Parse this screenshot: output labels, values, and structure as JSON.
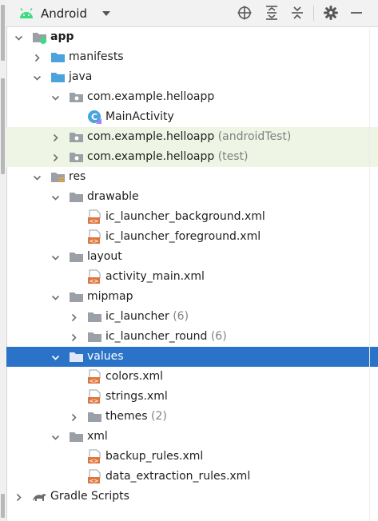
{
  "toolbar": {
    "view_name": "Android",
    "icons": [
      "android-logo-icon",
      "chevron-down-icon",
      "locate-target-icon",
      "expand-all-icon",
      "collapse-all-icon",
      "gear-icon",
      "minimize-icon"
    ]
  },
  "tree": {
    "rows": [
      {
        "id": "app",
        "label": "app",
        "suffix": "",
        "depth": 0,
        "arrow": "down",
        "icon": "module",
        "bold": true
      },
      {
        "id": "manifests",
        "label": "manifests",
        "suffix": "",
        "depth": 1,
        "arrow": "right",
        "icon": "folder-blue"
      },
      {
        "id": "java",
        "label": "java",
        "suffix": "",
        "depth": 1,
        "arrow": "down",
        "icon": "folder-blue"
      },
      {
        "id": "pkg-main",
        "label": "com.example.helloapp",
        "suffix": "",
        "depth": 2,
        "arrow": "down",
        "icon": "package"
      },
      {
        "id": "main-activity",
        "label": "MainActivity",
        "suffix": "",
        "depth": 3,
        "arrow": "none",
        "icon": "kotlin-class"
      },
      {
        "id": "pkg-android-test",
        "label": "com.example.helloapp",
        "suffix": "(androidTest)",
        "depth": 2,
        "arrow": "right",
        "icon": "package",
        "highlight": true
      },
      {
        "id": "pkg-test",
        "label": "com.example.helloapp",
        "suffix": "(test)",
        "depth": 2,
        "arrow": "right",
        "icon": "package",
        "highlight": true
      },
      {
        "id": "res",
        "label": "res",
        "suffix": "",
        "depth": 1,
        "arrow": "down",
        "icon": "res-folder"
      },
      {
        "id": "drawable",
        "label": "drawable",
        "suffix": "",
        "depth": 2,
        "arrow": "down",
        "icon": "folder-gray"
      },
      {
        "id": "ic-launcher-background",
        "label": "ic_launcher_background.xml",
        "suffix": "",
        "depth": 3,
        "arrow": "none",
        "icon": "xml-file"
      },
      {
        "id": "ic-launcher-foreground",
        "label": "ic_launcher_foreground.xml",
        "suffix": "",
        "depth": 3,
        "arrow": "none",
        "icon": "xml-file"
      },
      {
        "id": "layout",
        "label": "layout",
        "suffix": "",
        "depth": 2,
        "arrow": "down",
        "icon": "folder-gray"
      },
      {
        "id": "activity-main",
        "label": "activity_main.xml",
        "suffix": "",
        "depth": 3,
        "arrow": "none",
        "icon": "layout-file"
      },
      {
        "id": "mipmap",
        "label": "mipmap",
        "suffix": "",
        "depth": 2,
        "arrow": "down",
        "icon": "folder-gray"
      },
      {
        "id": "ic-launcher",
        "label": "ic_launcher",
        "suffix": "(6)",
        "depth": 3,
        "arrow": "right",
        "icon": "folder-gray"
      },
      {
        "id": "ic-launcher-round",
        "label": "ic_launcher_round",
        "suffix": "(6)",
        "depth": 3,
        "arrow": "right",
        "icon": "folder-gray"
      },
      {
        "id": "values",
        "label": "values",
        "suffix": "",
        "depth": 2,
        "arrow": "down",
        "icon": "folder-gray",
        "selected": true
      },
      {
        "id": "colors",
        "label": "colors.xml",
        "suffix": "",
        "depth": 3,
        "arrow": "none",
        "icon": "xml-file"
      },
      {
        "id": "strings",
        "label": "strings.xml",
        "suffix": "",
        "depth": 3,
        "arrow": "none",
        "icon": "xml-file"
      },
      {
        "id": "themes",
        "label": "themes",
        "suffix": "(2)",
        "depth": 3,
        "arrow": "right",
        "icon": "folder-gray"
      },
      {
        "id": "xml",
        "label": "xml",
        "suffix": "",
        "depth": 2,
        "arrow": "down",
        "icon": "folder-gray"
      },
      {
        "id": "backup-rules",
        "label": "backup_rules.xml",
        "suffix": "",
        "depth": 3,
        "arrow": "none",
        "icon": "xml-file"
      },
      {
        "id": "data-extraction-rules",
        "label": "data_extraction_rules.xml",
        "suffix": "",
        "depth": 3,
        "arrow": "none",
        "icon": "xml-file"
      },
      {
        "id": "gradle-scripts",
        "label": "Gradle Scripts",
        "suffix": "",
        "depth": 0,
        "arrow": "right",
        "icon": "gradle"
      }
    ]
  },
  "colors": {
    "selection": "#2a73c8",
    "highlight": "#eef5e4",
    "android_green": "#3ddc84",
    "folder_blue": "#4aa3dc",
    "xml_orange": "#e0763e",
    "muted_text": "#808080"
  }
}
